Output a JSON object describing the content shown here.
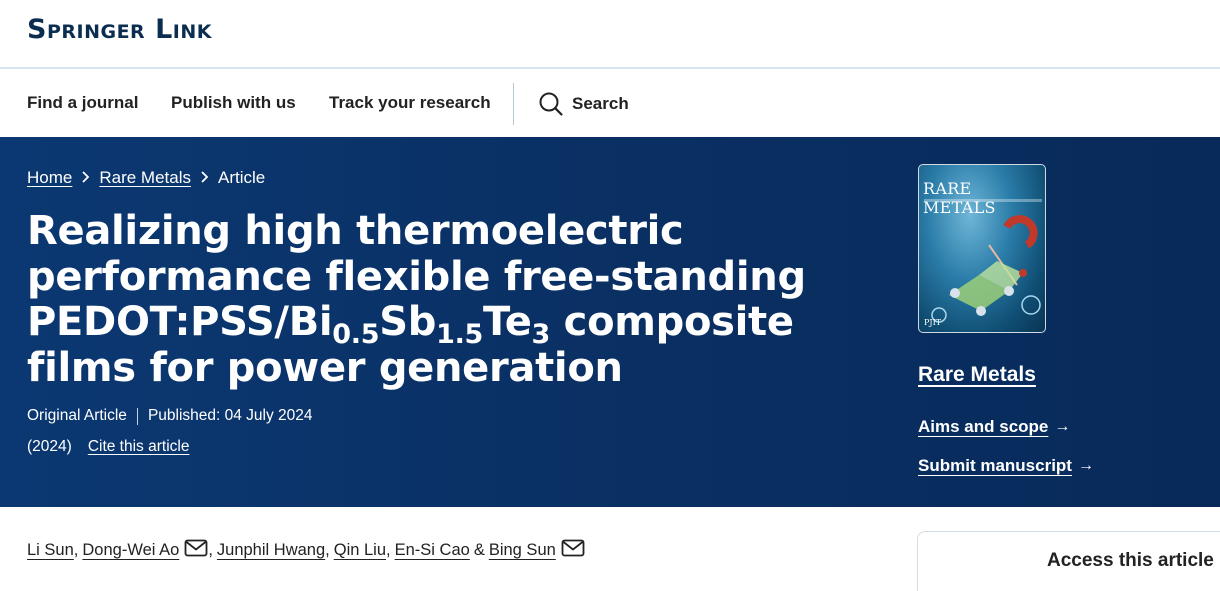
{
  "brand": {
    "logo": "Springer Link"
  },
  "nav": {
    "find_journal": "Find a journal",
    "publish": "Publish with us",
    "track": "Track your research",
    "search": "Search"
  },
  "breadcrumb": {
    "home": "Home",
    "journal": "Rare Metals",
    "current": "Article"
  },
  "article": {
    "title_part1": "Realizing high thermoelectric performance flexible free-standing PEDOT:PSS/Bi",
    "sub1": "0.5",
    "title_part2": "Sb",
    "sub2": "1.5",
    "title_part3": "Te",
    "sub3": "3",
    "title_part4": " composite films for power generation",
    "type": "Original Article",
    "published": "Published: 04 July 2024",
    "year": "(2024)",
    "cite": "Cite this article"
  },
  "journal_card": {
    "cover_title": "RARE METALS",
    "cover_mark": "PJIT",
    "name": "Rare Metals",
    "aims": "Aims and scope",
    "submit": "Submit manuscript",
    "arrow": "→"
  },
  "authors": {
    "a1": "Li Sun",
    "a2": "Dong-Wei Ao",
    "a3": "Junphil Hwang",
    "a4": "Qin Liu",
    "a5": "En-Si Cao",
    "amp": "&",
    "a6": "Bing Sun",
    "comma": ","
  },
  "access": {
    "title": "Access this article"
  },
  "colors": {
    "hero": "#0a2f62",
    "logo": "#0b2d4f"
  }
}
